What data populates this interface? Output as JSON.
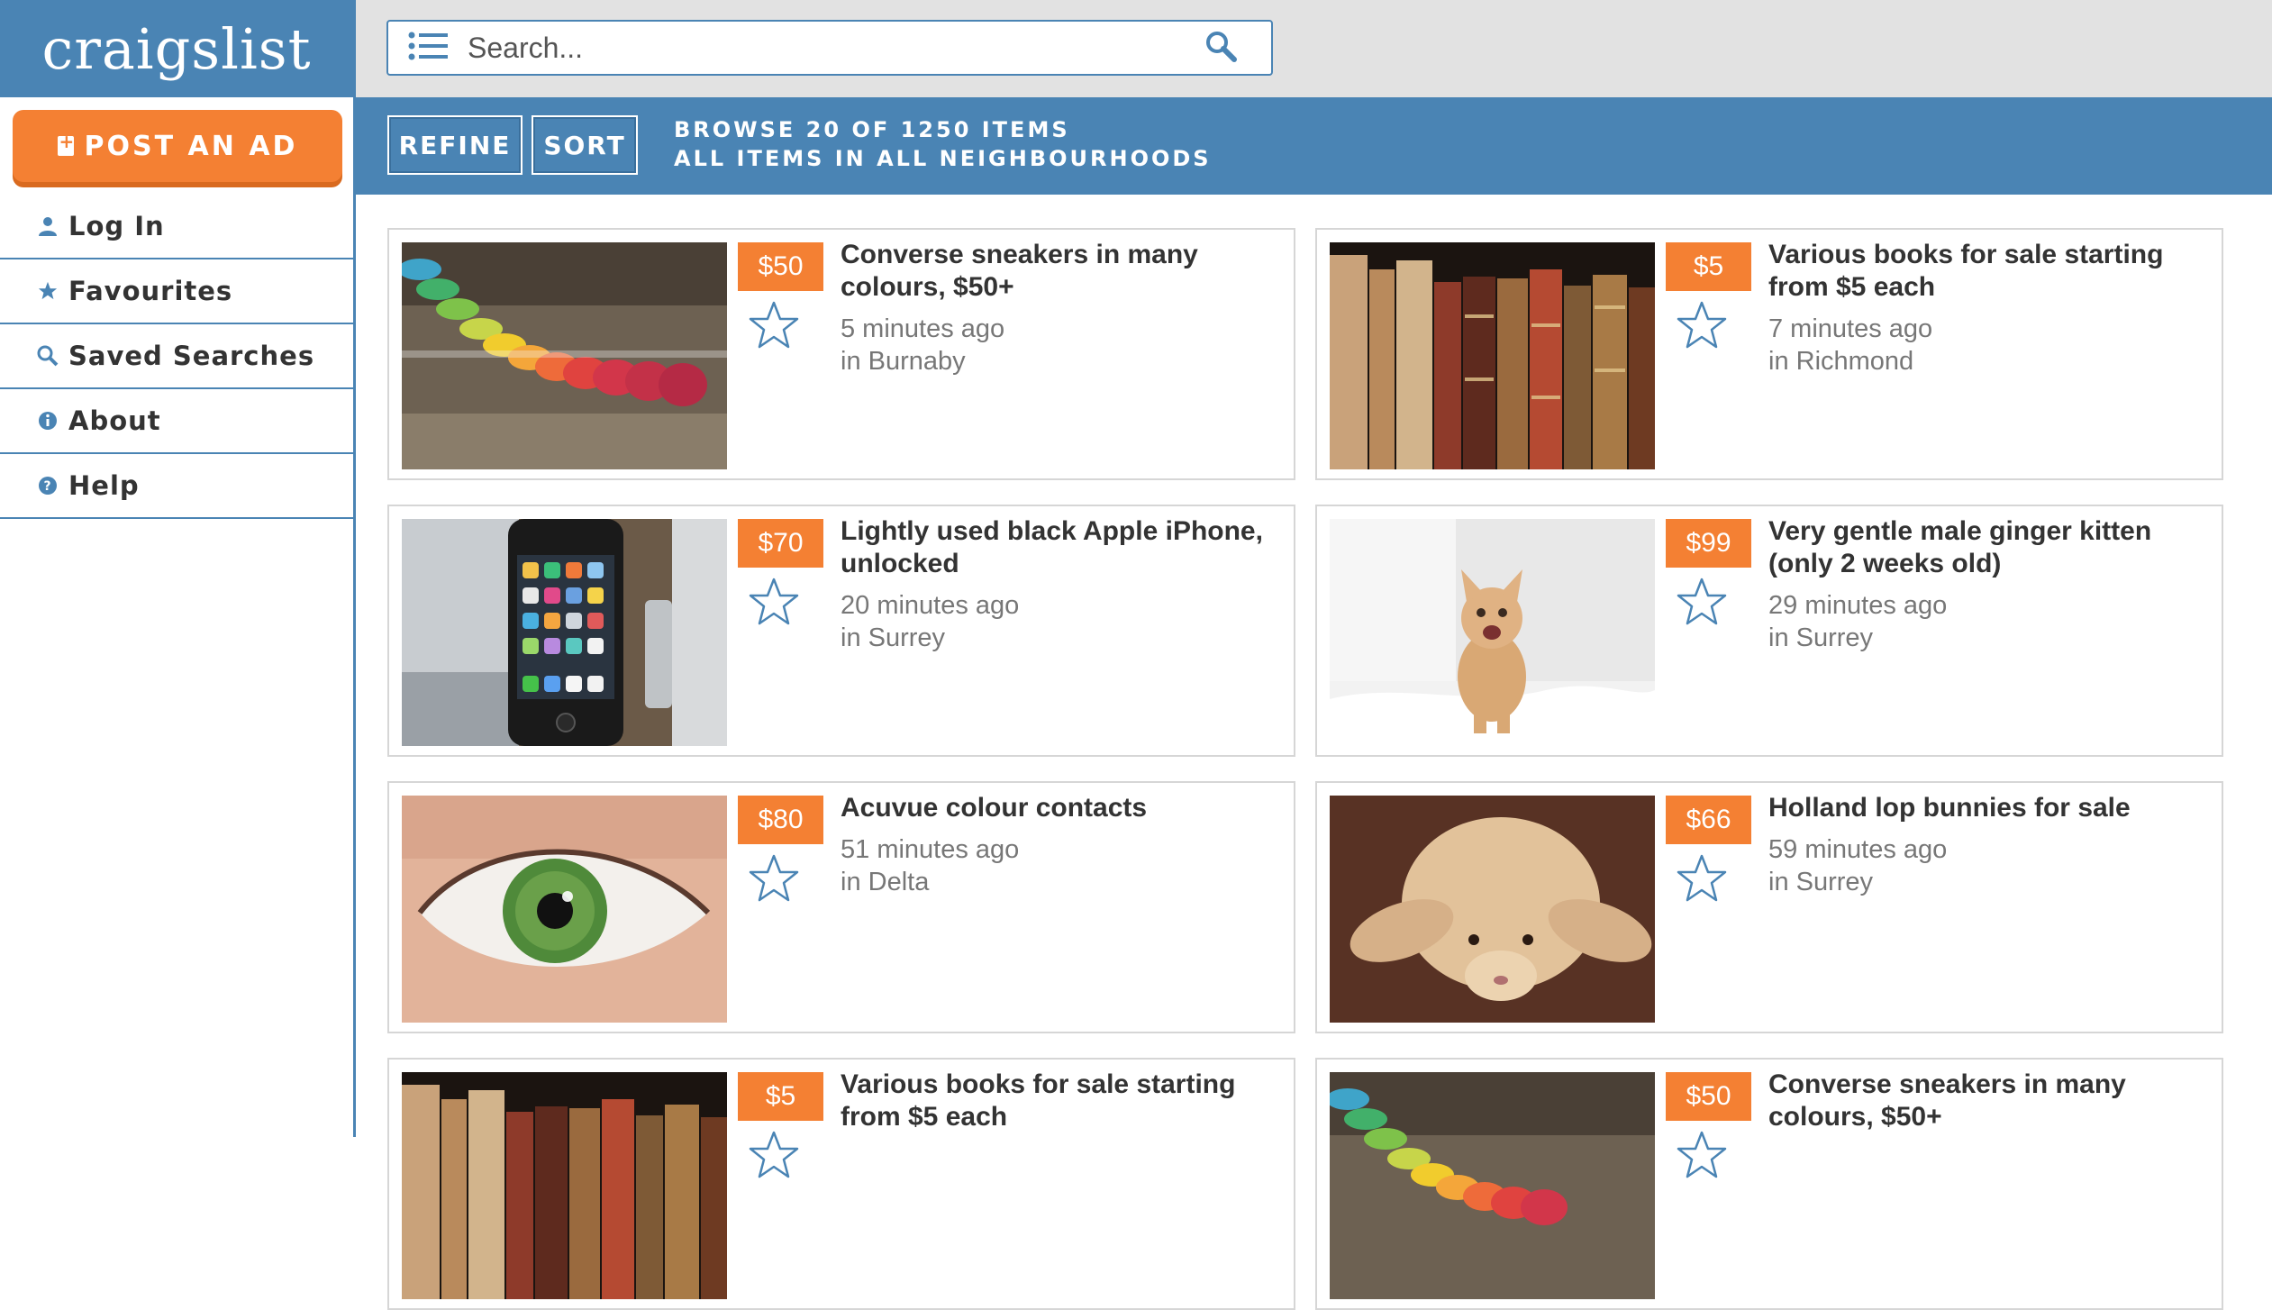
{
  "app": {
    "logo": "craigslist"
  },
  "sidebar": {
    "post_ad_label": "POST AN AD",
    "items": [
      {
        "label": "Log In",
        "icon": "user-icon"
      },
      {
        "label": "Favourites",
        "icon": "star-icon"
      },
      {
        "label": "Saved Searches",
        "icon": "magnifier-icon"
      },
      {
        "label": "About",
        "icon": "info-icon"
      },
      {
        "label": "Help",
        "icon": "help-icon"
      }
    ]
  },
  "search": {
    "placeholder": "Search..."
  },
  "results_bar": {
    "refine_label": "REFINE",
    "sort_label": "SORT",
    "browse_line1": "BROWSE 20 OF 1250 ITEMS",
    "browse_line2": "ALL ITEMS IN ALL NEIGHBOURHOODS"
  },
  "listings": [
    {
      "price": "$50",
      "title": "Converse sneakers in many colours, $50+",
      "time": "5 minutes ago",
      "location": "in Burnaby",
      "image": "sneakers"
    },
    {
      "price": "$5",
      "title": "Various books for sale starting from $5 each",
      "time": "7 minutes ago",
      "location": "in Richmond",
      "image": "books"
    },
    {
      "price": "$70",
      "title": "Lightly used black Apple iPhone, unlocked",
      "time": "20 minutes ago",
      "location": "in Surrey",
      "image": "iphone"
    },
    {
      "price": "$99",
      "title": "Very gentle male ginger kitten (only 2 weeks old)",
      "time": "29 minutes ago",
      "location": "in Surrey",
      "image": "kitten"
    },
    {
      "price": "$80",
      "title": "Acuvue colour contacts",
      "time": "51 minutes ago",
      "location": "in Delta",
      "image": "eye"
    },
    {
      "price": "$66",
      "title": "Holland lop bunnies for sale",
      "time": "59 minutes ago",
      "location": "in Surrey",
      "image": "bunny"
    },
    {
      "price": "$5",
      "title": "Various books for sale starting from $5 each",
      "time": "",
      "location": "",
      "image": "books"
    },
    {
      "price": "$50",
      "title": "Converse sneakers in many colours, $50+",
      "time": "",
      "location": "",
      "image": "sneakers"
    }
  ],
  "colors": {
    "accent": "#4a84b4",
    "orange": "#f48033",
    "topbar": "#e2e2e2"
  }
}
